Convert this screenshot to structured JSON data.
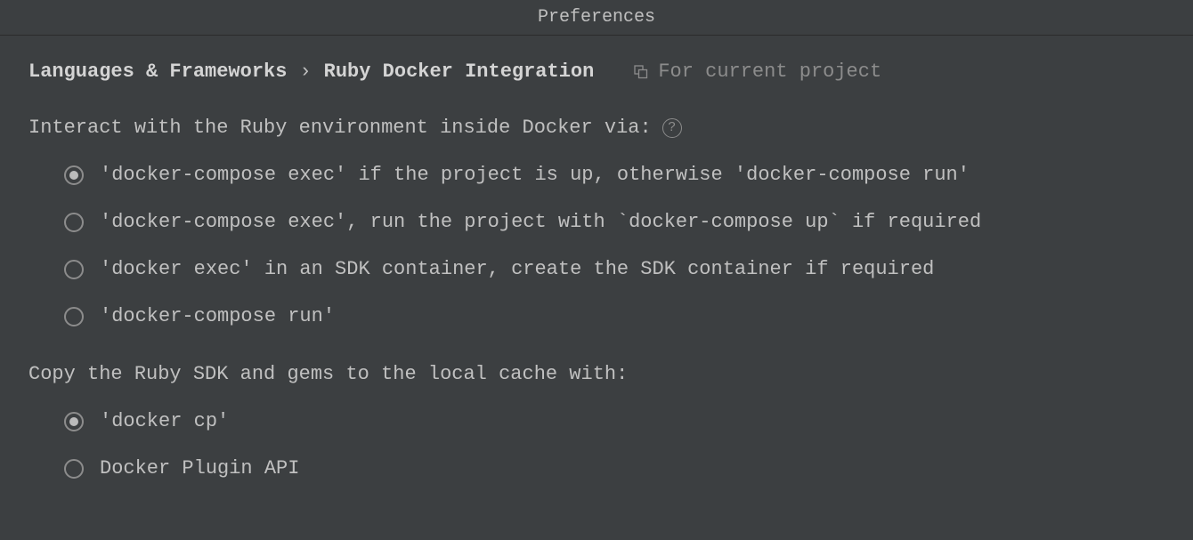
{
  "window": {
    "title": "Preferences"
  },
  "breadcrumb": {
    "parent": "Languages & Frameworks",
    "chev": "›",
    "current": "Ruby Docker Integration"
  },
  "scope": {
    "label": "For current project"
  },
  "sections": {
    "interact": {
      "label": "Interact with the Ruby environment inside Docker via:",
      "help": "?",
      "options": [
        "'docker-compose exec' if the project is up, otherwise 'docker-compose run'",
        "'docker-compose exec', run the project with `docker-compose up` if required",
        "'docker exec' in an SDK container, create the SDK container if required",
        "'docker-compose run'"
      ],
      "selected": 0
    },
    "copy": {
      "label": "Copy the Ruby SDK and gems to the local cache with:",
      "options": [
        "'docker cp'",
        "Docker Plugin API"
      ],
      "selected": 0
    }
  }
}
